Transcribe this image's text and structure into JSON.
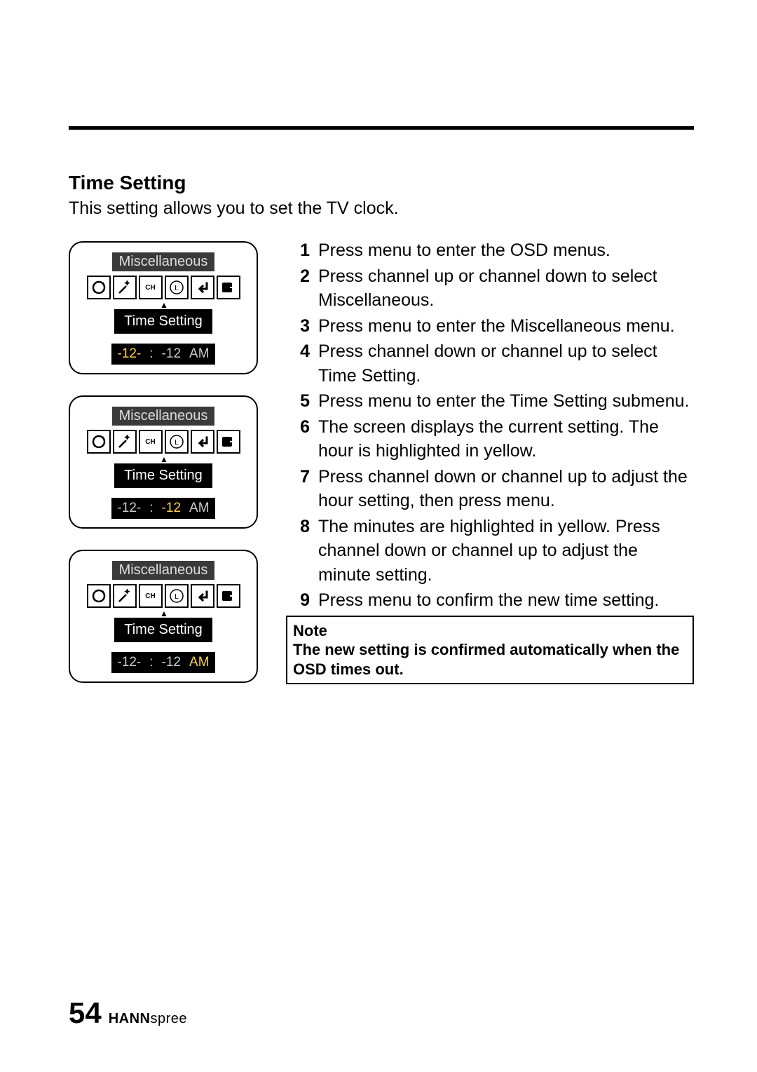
{
  "heading": "Time Setting",
  "intro": "This setting allows you to set the TV clock.",
  "osd": {
    "title": "Miscellaneous",
    "sub_title": "Time Setting",
    "time_hour": "-12-",
    "time_colon": ":",
    "time_min": "-12",
    "time_ampm": "AM",
    "ch_label": "CH",
    "l_label": "L"
  },
  "steps": [
    {
      "n": "1",
      "t": "Press menu to enter the OSD menus."
    },
    {
      "n": "2",
      "t": "Press channel up or channel down to select Miscellaneous."
    },
    {
      "n": "3",
      "t": "Press menu to enter the Miscellaneous menu."
    },
    {
      "n": "4",
      "t": "Press channel down or channel up to select Time Setting."
    },
    {
      "n": "5",
      "t": "Press menu to enter the Time Setting submenu."
    },
    {
      "n": "6",
      "t": "The screen displays the current setting. The hour is highlighted in yellow."
    },
    {
      "n": "7",
      "t": "Press channel down or channel up to adjust the hour setting, then press menu."
    },
    {
      "n": "8",
      "t": "The minutes are highlighted in yellow. Press channel down or channel up to adjust the minute setting."
    },
    {
      "n": "9",
      "t": "Press menu to confirm the new time setting."
    }
  ],
  "note": {
    "label": "Note",
    "text": "The new setting is confirmed automatically when the OSD times out."
  },
  "footer": {
    "page": "54",
    "brand_bold": "HANN",
    "brand_rest": "spree"
  }
}
